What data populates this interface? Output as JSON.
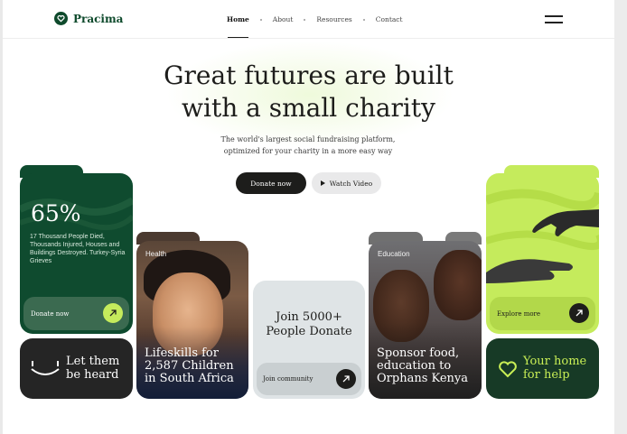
{
  "brand": {
    "name": "Pracima"
  },
  "nav": {
    "items": [
      {
        "label": "Home",
        "active": true
      },
      {
        "label": "About",
        "active": false
      },
      {
        "label": "Resources",
        "active": false
      },
      {
        "label": "Contact",
        "active": false
      }
    ],
    "menu_icon": "hamburger-icon"
  },
  "hero": {
    "headline_line1": "Great futures are built",
    "headline_line2": "with a small charity",
    "subtext_line1": "The world's largest social fundraising platform,",
    "subtext_line2": "optimized for your charity in a more easy way",
    "primary_button": "Donate now",
    "secondary_button": "Watch Video"
  },
  "cards": {
    "stat": {
      "value": "65%",
      "description": "17 Thousand People Died, Thousands Injured, Houses and Buildings Destroyed. Turkey-Syria Grieves",
      "action_label": "Donate now"
    },
    "heard": {
      "line1": "Let them",
      "line2": "be heard"
    },
    "health": {
      "tag": "Health",
      "title_line1": "Lifeskills for",
      "title_line2": "2,587 Children",
      "title_line3": "in South Africa"
    },
    "join": {
      "title_line1": "Join 5000+",
      "title_line2": "People Donate",
      "action_label": "Join community"
    },
    "education": {
      "tag": "Education",
      "title_line1": "Sponsor food,",
      "title_line2": "education to",
      "title_line3": "Orphans Kenya"
    },
    "explore": {
      "action_label": "Explore more"
    },
    "home": {
      "line1": "Your home",
      "line2": "for help"
    }
  },
  "colors": {
    "brand_green": "#0e4a2c",
    "lime": "#c5eb5c",
    "dark": "#1d1d1b"
  }
}
